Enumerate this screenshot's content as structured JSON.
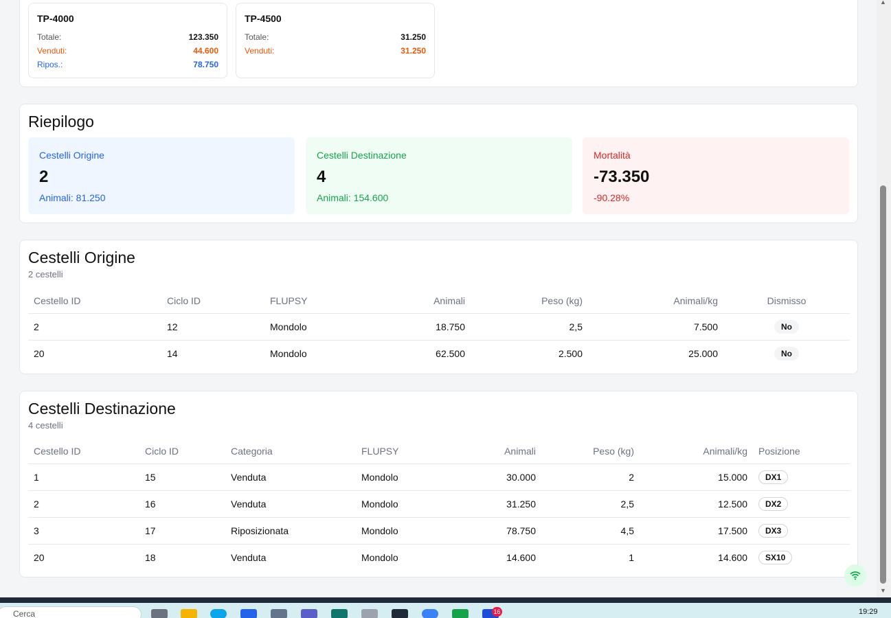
{
  "products": [
    {
      "name": "TP-4000",
      "rows": [
        {
          "label": "Totale:",
          "value": "123.350",
          "tone": "default"
        },
        {
          "label": "Venduti:",
          "value": "44.600",
          "tone": "orange"
        },
        {
          "label": "Ripos.:",
          "value": "78.750",
          "tone": "blue"
        }
      ]
    },
    {
      "name": "TP-4500",
      "rows": [
        {
          "label": "Totale:",
          "value": "31.250",
          "tone": "default"
        },
        {
          "label": "Venduti:",
          "value": "31.250",
          "tone": "orange"
        }
      ]
    }
  ],
  "summary": {
    "title": "Riepilogo",
    "origin": {
      "label": "Cestelli Origine",
      "value": "2",
      "foot": "Animali: 81.250"
    },
    "destination": {
      "label": "Cestelli Destinazione",
      "value": "4",
      "foot": "Animali: 154.600"
    },
    "mortality": {
      "label": "Mortalità",
      "value": "-73.350",
      "foot": "-90.28%"
    }
  },
  "origin": {
    "title": "Cestelli Origine",
    "subtitle": "2 cestelli",
    "headers": [
      "Cestello ID",
      "Ciclo ID",
      "FLUPSY",
      "Animali",
      "Peso (kg)",
      "Animali/kg",
      "Dismisso"
    ],
    "rows": [
      [
        "2",
        "12",
        "Mondolo",
        "18.750",
        "2,5",
        "7.500",
        "No"
      ],
      [
        "20",
        "14",
        "Mondolo",
        "62.500",
        "2.500",
        "25.000",
        "No"
      ]
    ]
  },
  "destination": {
    "title": "Cestelli Destinazione",
    "subtitle": "4 cestelli",
    "headers": [
      "Cestello ID",
      "Ciclo ID",
      "Categoria",
      "FLUPSY",
      "Animali",
      "Peso (kg)",
      "Animali/kg",
      "Posizione"
    ],
    "rows": [
      [
        "1",
        "15",
        "Venduta",
        "Mondolo",
        "30.000",
        "2",
        "15.000",
        "DX1"
      ],
      [
        "2",
        "16",
        "Venduta",
        "Mondolo",
        "31.250",
        "2,5",
        "12.500",
        "DX2"
      ],
      [
        "3",
        "17",
        "Riposizionata",
        "Mondolo",
        "78.750",
        "4,5",
        "17.500",
        "DX3"
      ],
      [
        "20",
        "18",
        "Venduta",
        "Mondolo",
        "14.600",
        "1",
        "14.600",
        "SX10"
      ]
    ]
  },
  "taskbar": {
    "search_placeholder": "Cerca",
    "badge": "16",
    "time": "19:29"
  },
  "colors": {
    "orange": "#ea580c",
    "blue": "#2563eb",
    "green": "#16a34a",
    "red": "#dc2626"
  }
}
